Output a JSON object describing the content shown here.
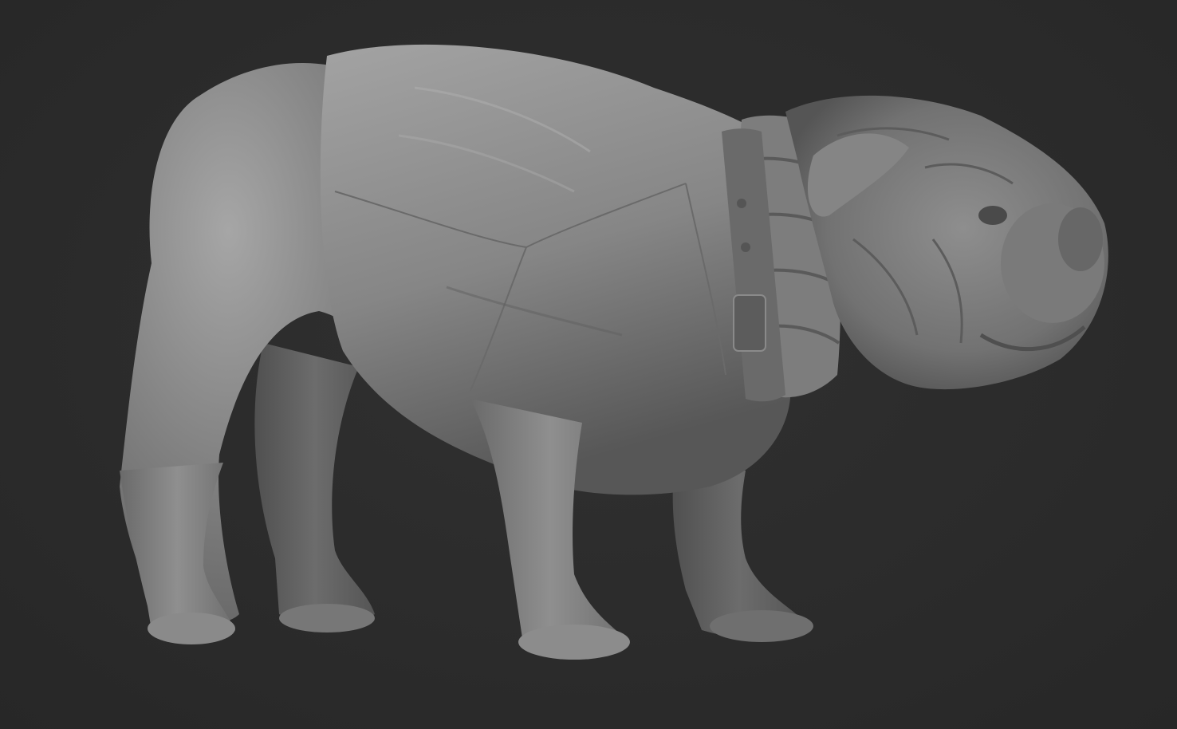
{
  "viewport": {
    "background_color": "#2b2b2b",
    "subject": {
      "icon": "bulldog-sculpt-icon",
      "material_color": "#8a8a8a"
    }
  }
}
